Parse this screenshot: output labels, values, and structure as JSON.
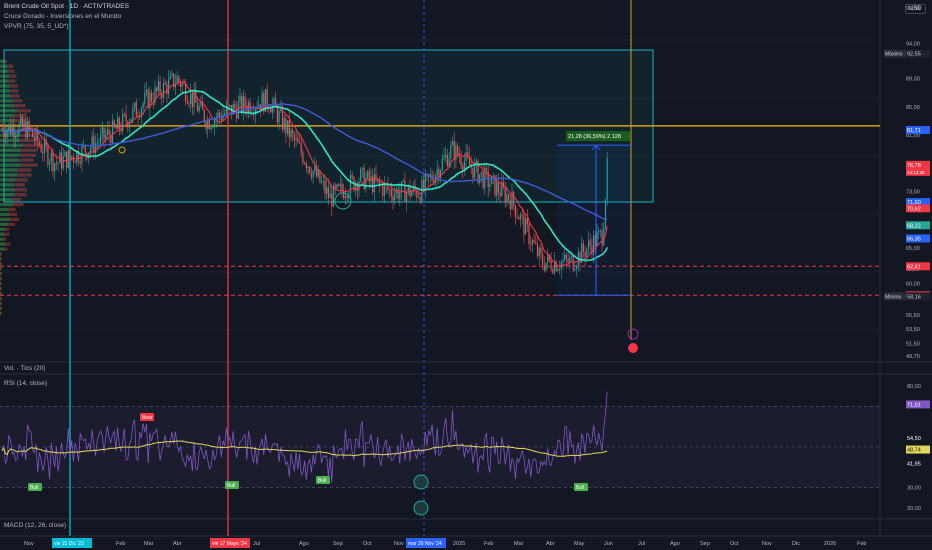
{
  "header": {
    "symbol_title": "Brent Crude Oil Spot · 1D · ACTIVTRADES",
    "indicator_1": "Cruce Dorado - Inversiones en el Mundo",
    "indicator_2": "VPVR (75, 35, 5_UD*)",
    "currency": "USD"
  },
  "colors": {
    "background": "#131722",
    "candle_up": "#26a69a",
    "candle_down": "#ef5350",
    "ema_fast": "#f23645",
    "ema_mid": "#2ee6c0",
    "ema_slow": "#3d5bd9",
    "range_box": "#12b5c4",
    "orange_level": "#d4a017",
    "rsi_line": "#7e57c2",
    "rsi_ma": "#e6d75a",
    "support_dash": "#f23645"
  },
  "price_axis": {
    "ticks": [
      "99,00",
      "94,00",
      "89,00",
      "85,00",
      "81,00",
      "77,00",
      "73,00",
      "65,00",
      "62,00",
      "60,00",
      "58,00",
      "55,50",
      "53,50",
      "51,50",
      "49,70"
    ],
    "badges": [
      {
        "text": "Máximo",
        "value": "92,55",
        "color": "#2a2e39",
        "value_color": "#d1d4dc"
      },
      {
        "text": "",
        "value": "81,71",
        "color": "#2962ff"
      },
      {
        "text": "",
        "value": "76,78",
        "sub": "14:12:36",
        "color": "#f23645"
      },
      {
        "text": "",
        "value": "71,50",
        "color": "#2962ff"
      },
      {
        "text": "",
        "value": "70,62",
        "color": "#f23645"
      },
      {
        "text": "",
        "value": "68,22",
        "color": "#26a69a"
      },
      {
        "text": "",
        "value": "66,35",
        "color": "#2962ff"
      },
      {
        "text": "",
        "value": "62,41",
        "color": "#f23645"
      },
      {
        "text": "",
        "value": "58,30",
        "color": "#f23645"
      },
      {
        "text": "Mínimo",
        "value": "58,16",
        "color": "#2a2e39",
        "value_color": "#d1d4dc"
      }
    ]
  },
  "annotations": {
    "measure_label": "21,28 (36,59%) 2.128"
  },
  "volume_panel": {
    "title": "Vol. · Tics (20)"
  },
  "rsi_panel": {
    "title": "RSI (14, close)",
    "ticks": [
      "80,00",
      "30,00",
      "20,00"
    ],
    "badges": [
      {
        "value": "71,01",
        "color": "#7e57c2"
      },
      {
        "value": "54,50",
        "color": "#131722"
      },
      {
        "value": "48,74",
        "color": "#e6d75a"
      },
      {
        "value": "41,95",
        "color": "#131722"
      }
    ],
    "labels": [
      {
        "text": "Bear",
        "kind": "bear"
      },
      {
        "text": "Bull",
        "kind": "bull"
      },
      {
        "text": "Bull",
        "kind": "bull"
      },
      {
        "text": "Bull",
        "kind": "bull"
      },
      {
        "text": "Bull",
        "kind": "bull"
      }
    ]
  },
  "macd_panel": {
    "title": "MACD (12, 26, close)"
  },
  "time_axis": {
    "labels": [
      "Nov",
      "Feb",
      "Mar",
      "Abr",
      "Jul",
      "Ago",
      "Sep",
      "Oct",
      "Nov",
      "2025",
      "Feb",
      "Mar",
      "Abr",
      "May",
      "Jun",
      "Jul",
      "Ago",
      "Sep",
      "Oct",
      "Nov",
      "Dic",
      "2026",
      "Feb",
      "Mar"
    ],
    "highlights": [
      {
        "text": "vie 15 Dic '23",
        "color": "#00bcd4"
      },
      {
        "text": "vie 17 Mayo '24",
        "color": "#f23645"
      },
      {
        "text": "mar 26 Nov '24",
        "color": "#2962ff"
      }
    ]
  },
  "chart_data": {
    "type": "candlestick",
    "title": "Brent Crude Oil Spot · 1D · ACTIVTRADES",
    "y_unit": "USD",
    "ylim": [
      49.7,
      99.0
    ],
    "x_range": [
      "2023-11",
      "2026-03"
    ],
    "key_levels": {
      "maximum": 92.55,
      "minimum": 58.16,
      "last": 76.78,
      "ema_20": 70.62,
      "ema_50": 68.22,
      "ema_200": 71.5,
      "blue_level_1": 81.71,
      "blue_level_2": 66.35,
      "support_1": 62.41,
      "support_2": 58.3
    },
    "measure": {
      "from": 58.3,
      "to": 79.58,
      "change": 21.28,
      "percent": 36.59
    },
    "close_series_approx": [
      {
        "x": "2023-11",
        "y": 82
      },
      {
        "x": "2023-12",
        "y": 77
      },
      {
        "x": "2024-01",
        "y": 79
      },
      {
        "x": "2024-02",
        "y": 82
      },
      {
        "x": "2024-03",
        "y": 86
      },
      {
        "x": "2024-04",
        "y": 89
      },
      {
        "x": "2024-05",
        "y": 83
      },
      {
        "x": "2024-06",
        "y": 85
      },
      {
        "x": "2024-07",
        "y": 86
      },
      {
        "x": "2024-08",
        "y": 79
      },
      {
        "x": "2024-09",
        "y": 72
      },
      {
        "x": "2024-10",
        "y": 75
      },
      {
        "x": "2024-11",
        "y": 73
      },
      {
        "x": "2024-12",
        "y": 73
      },
      {
        "x": "2025-01",
        "y": 79
      },
      {
        "x": "2025-02",
        "y": 75
      },
      {
        "x": "2025-03",
        "y": 72
      },
      {
        "x": "2025-04",
        "y": 63
      },
      {
        "x": "2025-05",
        "y": 63
      },
      {
        "x": "2025-06",
        "y": 67
      },
      {
        "x": "2025-06-20",
        "y": 77
      }
    ],
    "rsi": {
      "ylim": [
        20,
        80
      ],
      "last": 71.01,
      "ma_last": 48.74,
      "levels": [
        70,
        30
      ]
    }
  }
}
